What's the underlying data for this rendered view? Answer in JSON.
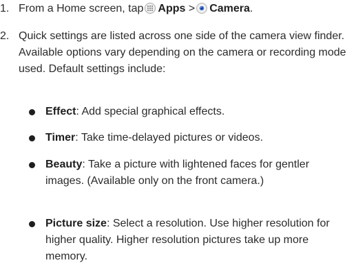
{
  "steps": [
    {
      "number": "1.",
      "prefix": "From a Home screen, tap",
      "apps_label": "Apps",
      "separator": ">",
      "camera_label": "Camera",
      "suffix": "."
    },
    {
      "number": "2.",
      "text": "Quick settings are listed across one side of the camera view finder. Available options vary depending on the camera or recording mode used. Default settings include:"
    }
  ],
  "bullets": [
    {
      "term": "Effect",
      "desc": ": Add special graphical effects."
    },
    {
      "term": "Timer",
      "desc": ": Take time-delayed pictures or videos."
    },
    {
      "term": "Beauty",
      "desc": ": Take a picture with lightened faces for gentler images. (Available only on the front camera.)"
    },
    {
      "term": "Picture size",
      "desc": ": Select a resolution. Use higher resolution for higher quality. Higher resolution pictures take up more memory."
    }
  ],
  "icons": {
    "apps": "apps-grid-icon",
    "camera": "camera-icon"
  }
}
